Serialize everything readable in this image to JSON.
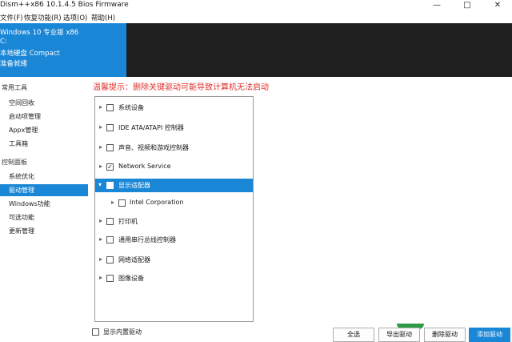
{
  "window": {
    "title": "Dism++x86 10.1.4.5 Bios Firmware",
    "controls": [
      "—",
      "□",
      "✕"
    ]
  },
  "menu": [
    "文件(F)",
    "恢复功能(R)",
    "选项(O)",
    "帮助(H)"
  ],
  "system": {
    "os": "Windows 10 专业版 x86",
    "line2": "C:",
    "line3": "本地硬盘 Compact",
    "line4": "准备就绪"
  },
  "sidebar": {
    "section1": "常用工具",
    "items1": [
      "空间回收",
      "启动项管理",
      "Appx管理",
      "工具箱"
    ],
    "section2": "控制面板",
    "items2": [
      "系统优化",
      "驱动管理",
      "Windows功能",
      "可选功能",
      "更新管理"
    ],
    "active": "驱动管理"
  },
  "tip": "温馨提示：删除关键驱动可能导致计算机无法启动",
  "tree": [
    {
      "label": "系统设备",
      "checked": false,
      "level": 0
    },
    {
      "label": "IDE ATA/ATAPI 控制器",
      "checked": false,
      "level": 0
    },
    {
      "label": "声音、视频和游戏控制器",
      "checked": false,
      "level": 0
    },
    {
      "label": "Network Service",
      "checked": true,
      "level": 0
    },
    {
      "label": "显示适配器",
      "checked": false,
      "level": 0,
      "expanded": true,
      "selected": true
    },
    {
      "label": "Intel Corporation",
      "checked": false,
      "level": 1
    },
    {
      "label": "打印机",
      "checked": false,
      "level": 0
    },
    {
      "label": "通用串行总线控制器",
      "checked": false,
      "level": 0
    },
    {
      "label": "网络适配器",
      "checked": false,
      "level": 0
    },
    {
      "label": "图像设备",
      "checked": false,
      "level": 0
    }
  ],
  "show_builtin": "显示内置驱动",
  "buttons": {
    "select_all": "全选",
    "export": "导出驱动",
    "delete": "删除驱动",
    "add": "添加驱动"
  },
  "colors": {
    "accent": "#1a86d6",
    "warning": "#e0302a",
    "header_dark": "#1f1f1f"
  }
}
